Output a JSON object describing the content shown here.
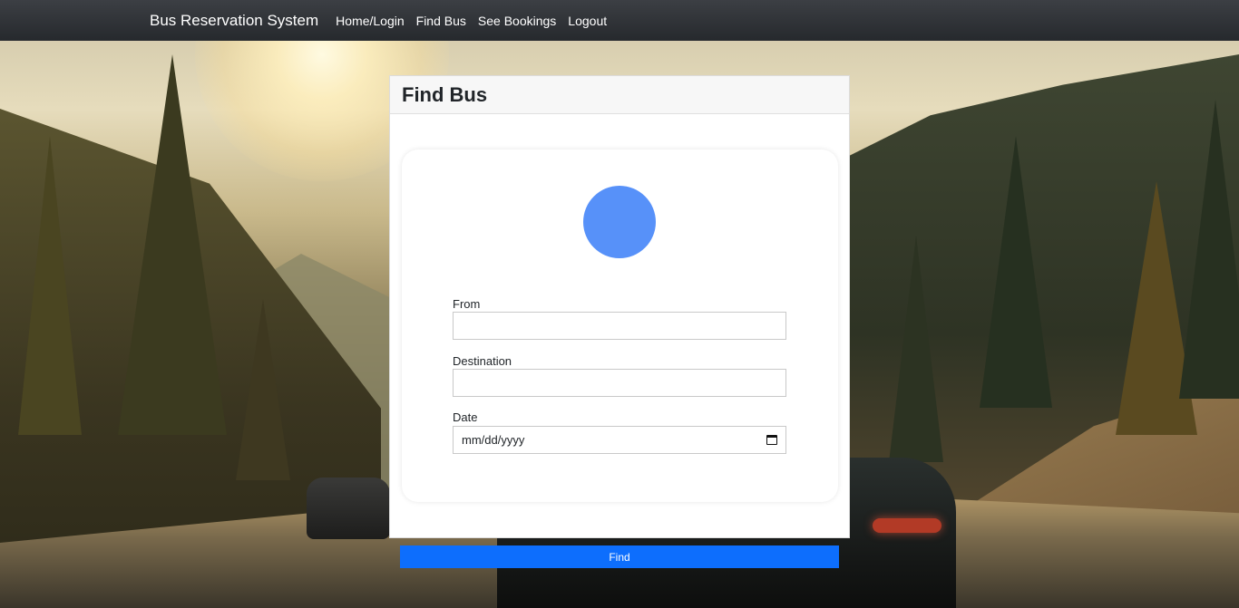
{
  "navbar": {
    "brand": "Bus Reservation System",
    "links": [
      "Home/Login",
      "Find Bus",
      "See Bookings",
      "Logout"
    ]
  },
  "panel": {
    "title": "Find Bus"
  },
  "form": {
    "from_label": "From",
    "from_value": "",
    "destination_label": "Destination",
    "destination_value": "",
    "date_label": "Date",
    "date_placeholder": "mm/dd/yyyy",
    "submit_label": "Find"
  },
  "colors": {
    "navbar": "#2f3236",
    "accent_button": "#0d6efd",
    "avatar_circle": "#5791f9"
  },
  "icons": [
    "calendar-icon"
  ]
}
